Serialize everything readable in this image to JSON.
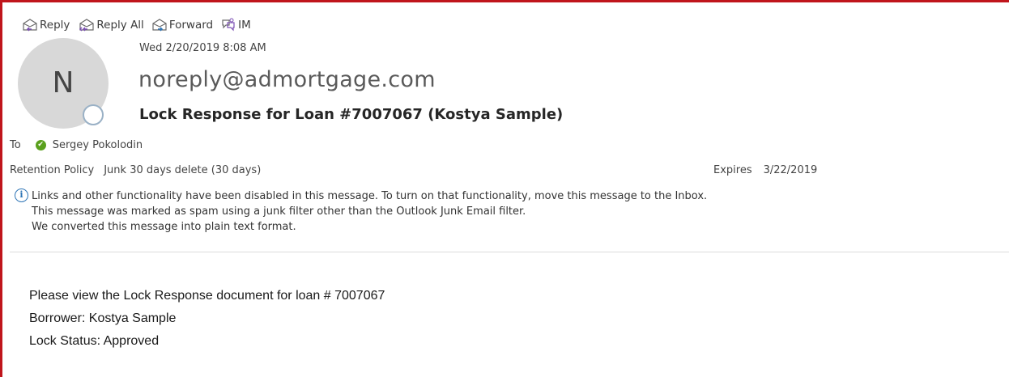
{
  "toolbar": {
    "reply_label": "Reply",
    "reply_all_label": "Reply All",
    "forward_label": "Forward",
    "im_label": "IM"
  },
  "message": {
    "date": "Wed 2/20/2019 8:08 AM",
    "avatar_letter": "N",
    "sender": "noreply@admortgage.com",
    "subject": "Lock Response for Loan #7007067 (Kostya Sample)",
    "to_label": "To",
    "recipient": "Sergey Pokolodin",
    "retention_label": "Retention Policy",
    "retention_value": "Junk 30 days delete (30 days)",
    "expires_label": "Expires",
    "expires_value": "3/22/2019",
    "info_lines": [
      "Links and other functionality have been disabled in this message. To turn on that functionality, move this message to the Inbox.",
      "This message was marked as spam using a junk filter other than the Outlook Junk Email filter.",
      "We converted this message into plain text format."
    ],
    "body_lines": [
      "Please view the Lock Response document for loan # 7007067",
      "Borrower: Kostya Sample",
      "Lock Status: Approved"
    ]
  },
  "colors": {
    "frame_accent": "#c0151c",
    "presence_ring": "#9ab1c6",
    "recipient_status": "#5aa01d",
    "info_blue": "#2e75b6"
  },
  "icons": {
    "reply": "reply-icon",
    "reply_all": "reply-all-icon",
    "forward": "forward-icon",
    "im": "im-icon",
    "info": "info-icon",
    "recipient_status": "check-circle-icon"
  }
}
